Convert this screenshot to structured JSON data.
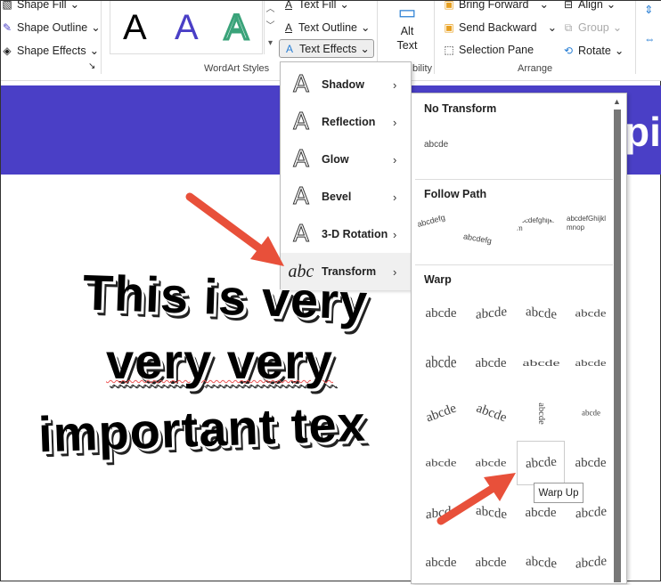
{
  "ribbon": {
    "shape_fill": "Shape Fill",
    "shape_outline": "Shape Outline",
    "shape_effects": "Shape Effects",
    "wordart_styles_label": "WordArt Styles",
    "wordart_samples": [
      "A",
      "A",
      "A"
    ],
    "text_fill": "Text Fill",
    "text_outline": "Text Outline",
    "text_effects": "Text Effects",
    "alt_text": "Alt Text",
    "accessibility_label": "bility",
    "bring_forward": "Bring Forward",
    "send_backward": "Send Backward",
    "selection_pane": "Selection Pane",
    "align": "Align",
    "group": "Group",
    "rotate": "Rotate",
    "arrange_label": "Arrange"
  },
  "slide": {
    "title_fragment": "pi",
    "lines": [
      "This is very",
      "very very",
      "important tex"
    ]
  },
  "text_effects_menu": {
    "items": [
      {
        "label": "Shadow",
        "icon": "shadow-a-icon"
      },
      {
        "label": "Reflection",
        "icon": "reflection-a-icon"
      },
      {
        "label": "Glow",
        "icon": "glow-a-icon"
      },
      {
        "label": "Bevel",
        "icon": "bevel-a-icon"
      },
      {
        "label": "3-D Rotation",
        "icon": "3d-rotation-a-icon"
      },
      {
        "label": "Transform",
        "icon": "abc-transform-icon"
      }
    ],
    "icon_glyphs": [
      "A",
      "A",
      "A",
      "A",
      "A",
      "abc"
    ]
  },
  "transform_gallery": {
    "no_transform": {
      "heading": "No Transform",
      "sample": "abcde"
    },
    "follow_path": {
      "heading": "Follow Path",
      "samples": [
        "abcdefg",
        "abcdefghijklm",
        "abcdefGhijklmnop"
      ]
    },
    "warp": {
      "heading": "Warp",
      "sample": "abcde",
      "selected": "Warp Up",
      "tooltip": "Warp Up"
    }
  },
  "colors": {
    "accent_purple": "#4a3fc6",
    "arrow_red": "#e8503a",
    "wordart_blue": "#4a3fc6",
    "wordart_green": "#3aa37a"
  }
}
